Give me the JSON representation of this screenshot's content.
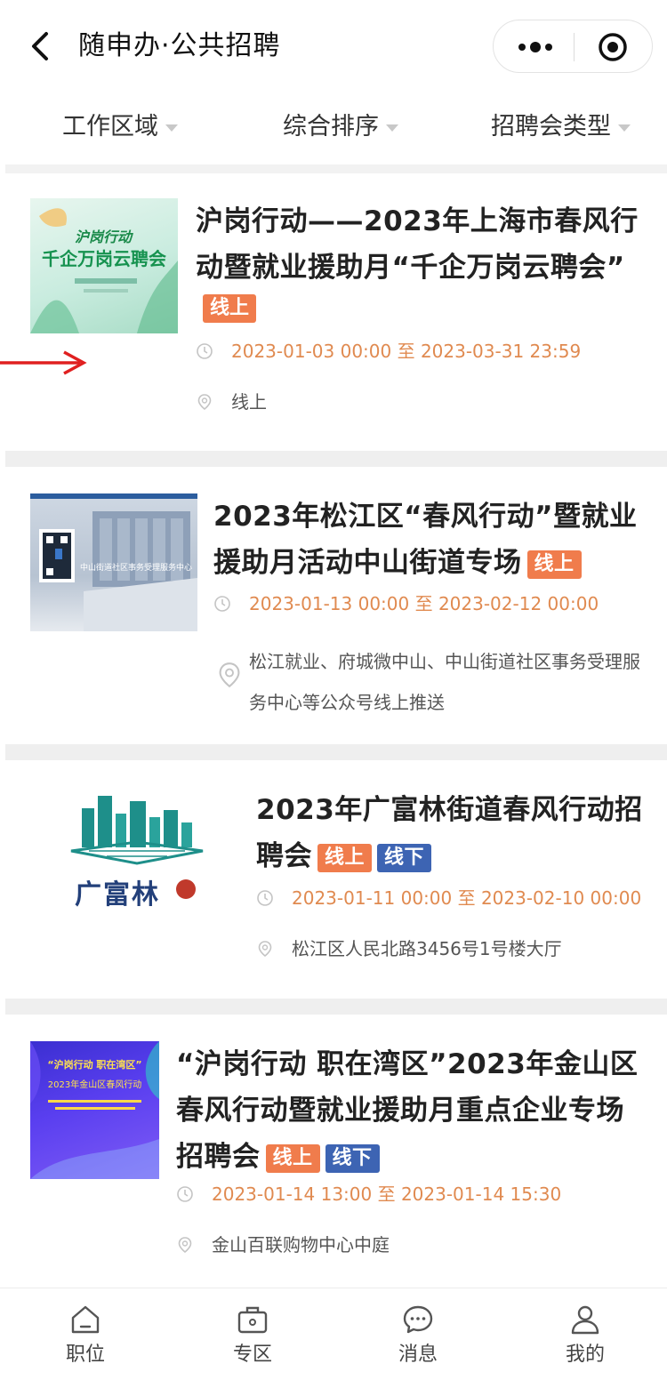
{
  "header": {
    "title": "随申办·公共招聘"
  },
  "filters": [
    {
      "label": "工作区域"
    },
    {
      "label": "综合排序"
    },
    {
      "label": "招聘会类型"
    }
  ],
  "cards": [
    {
      "title": "沪岗行动——2023年上海市春风行动暨就业援助月“千企万岗云聘会”",
      "tags": [
        "线上"
      ],
      "time": "2023-01-03 00:00 至 2023-03-31 23:59",
      "location": "线上",
      "thumb_text": {
        "line1": "沪岗行动",
        "line2": "千企万岗云聘会"
      }
    },
    {
      "title": "2023年松江区“春风行动”暨就业援助月活动中山街道专场",
      "tags": [
        "线上"
      ],
      "time": "2023-01-13 00:00 至 2023-02-12 00:00",
      "location": "松江就业、府城微中山、中山街道社区事务受理服务中心等公众号线上推送",
      "thumb_text": {
        "sign": "中山街道社区事务受理服务中心"
      }
    },
    {
      "title": "2023年广富林街道春风行动招聘会",
      "tags": [
        "线上",
        "线下"
      ],
      "time": "2023-01-11 00:00 至 2023-02-10 00:00",
      "location": "松江区人民北路3456号1号楼大厅",
      "thumb_text": {
        "logo": "广富林"
      }
    },
    {
      "title": "“沪岗行动 职在湾区”2023年金山区春风行动暨就业援助月重点企业专场招聘会",
      "tags": [
        "线上",
        "线下"
      ],
      "time": "2023-01-14 13:00 至 2023-01-14 15:30",
      "location": "金山百联购物中心中庭",
      "thumb_text": {
        "line1": "“沪岗行动 职在湾区”",
        "line2": "2023年金山区春风行动"
      }
    }
  ],
  "tabbar": [
    {
      "label": "职位",
      "icon": "home-icon"
    },
    {
      "label": "专区",
      "icon": "briefcase-icon"
    },
    {
      "label": "消息",
      "icon": "chat-icon"
    },
    {
      "label": "我的",
      "icon": "user-icon"
    }
  ],
  "colors": {
    "tag_online": "#f07c4c",
    "tag_offline": "#3d64b3",
    "time_text": "#e08a50",
    "annotation_arrow": "#e02020"
  }
}
